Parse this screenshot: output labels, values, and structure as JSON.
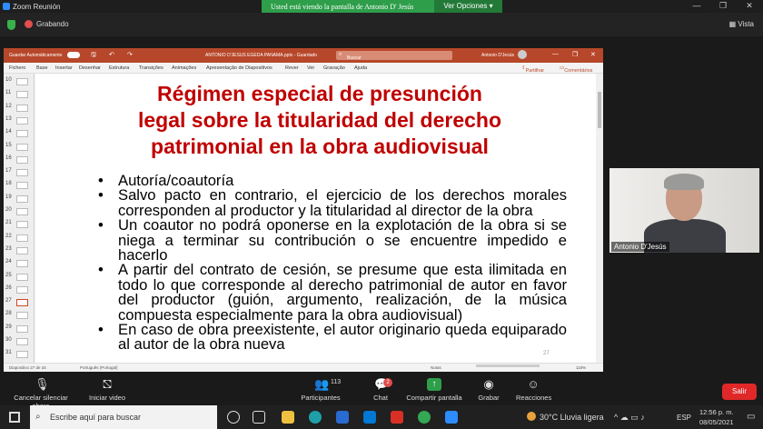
{
  "zoom": {
    "window_title": "Zoom Reunión",
    "share_banner": "Usted está viendo la pantalla de Antonio D' Jesús",
    "view_options": "Ver Opciones",
    "recording_label": "Grabando",
    "view_label": "Vista"
  },
  "ppt": {
    "autosave": "Guardar Automáticamente",
    "doc_title": "ANTONIO D'JESUS EGEDA PANAMA.pptx - Guardado",
    "search_placeholder": "Buscar",
    "user": "Antonio D'Jesús",
    "menu": [
      "Fichero",
      "Base",
      "Insertar",
      "Desenhar",
      "Estrutura",
      "Transições",
      "Animações",
      "Apresentação de Diapositivos",
      "Rever",
      "Ver",
      "Gravação",
      "Ajuda"
    ],
    "share": "Partilhar",
    "comments": "Comentários",
    "thumb_numbers": [
      "10",
      "11",
      "12",
      "13",
      "14",
      "15",
      "16",
      "17",
      "18",
      "19",
      "20",
      "21",
      "22",
      "23",
      "24",
      "25",
      "26",
      "27",
      "28",
      "29",
      "30",
      "31"
    ],
    "status_slide": "Diapositivo 27 de 34",
    "status_lang": "Português (Portugal)",
    "status_notes": "Notas",
    "zoom_pct": "116%"
  },
  "slide": {
    "title_line1": "Régimen especial de presunción",
    "title_line2": "legal sobre la titularidad del derecho",
    "title_line3": "patrimonial en la obra audiovisual",
    "bullets": [
      "Autoría/coautoría",
      "Salvo pacto en contrario, el ejercicio de los derechos morales corresponden al productor y la titularidad al director de la obra",
      "Un coautor no podrá oponerse en la explotación de la obra si se niega a terminar su contribución o se encuentre impedido e hacerlo",
      "A partir del contrato de cesión, se presume que esta ilimitada en todo lo que corresponde al derecho patrimonial de autor en favor del productor (guión, argumento, realización, de la música compuesta especialmente para la obra audiovisual)",
      "En caso de obra preexistente, el autor originario queda equiparado al autor de la obra nueva"
    ],
    "slide_number": "27"
  },
  "video": {
    "participant_name": "Antonio D'Jesús"
  },
  "toolbar": {
    "mute": "Cancelar silenciar ahora",
    "video": "Iniciar video",
    "participants": "Participantes",
    "participants_count": "113",
    "chat": "Chat",
    "chat_badge": "2",
    "share": "Compartir pantalla",
    "record": "Grabar",
    "reactions": "Reacciones",
    "leave": "Salir"
  },
  "taskbar": {
    "search_placeholder": "Escribe aquí para buscar",
    "weather": "30°C  Lluvia ligera",
    "lang": "ESP",
    "time": "12:56 p. m.",
    "date": "08/05/2021"
  }
}
